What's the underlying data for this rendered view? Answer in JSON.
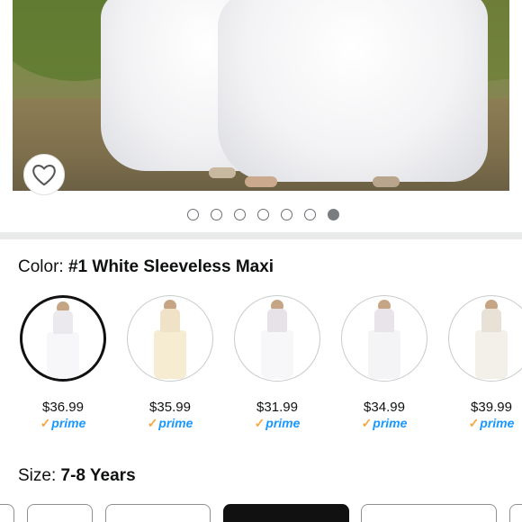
{
  "gallery": {
    "image_count": 7,
    "active_index": 6,
    "wishlist_icon": "heart-outline-icon"
  },
  "color": {
    "label": "Color: ",
    "selected": "#1 White Sleeveless Maxi",
    "options": [
      {
        "price": "$36.99",
        "prime": "prime",
        "skirt_color": "#f7f7fa",
        "bodice_color": "#ece9ee",
        "selected": true
      },
      {
        "price": "$35.99",
        "prime": "prime",
        "skirt_color": "#f6ecd2",
        "bodice_color": "#efe2c6",
        "selected": false
      },
      {
        "price": "$31.99",
        "prime": "prime",
        "skirt_color": "#f7f7fa",
        "bodice_color": "#e6e2e8",
        "selected": false
      },
      {
        "price": "$34.99",
        "prime": "prime",
        "skirt_color": "#f4f3f6",
        "bodice_color": "#e8e4ea",
        "selected": false
      },
      {
        "price": "$39.99",
        "prime": "prime",
        "skirt_color": "#f3f0ea",
        "bodice_color": "#e7e1d6",
        "selected": false
      }
    ]
  },
  "size": {
    "label": "Size: ",
    "selected": "7-8 Years"
  },
  "colors": {
    "prime_blue": "#1a98ff",
    "prime_check": "#f3a847",
    "selected_border": "#111111"
  }
}
